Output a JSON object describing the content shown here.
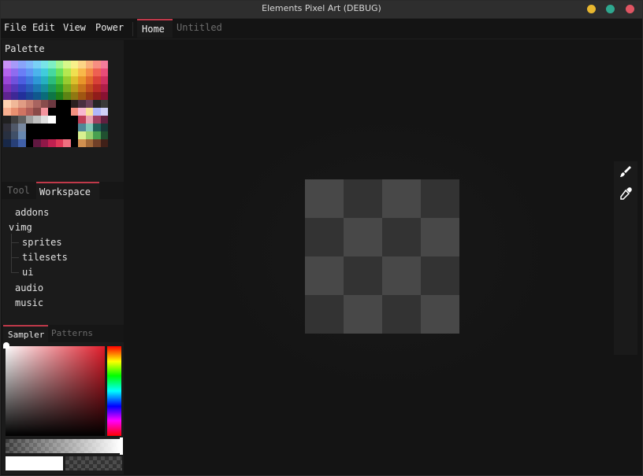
{
  "window": {
    "title": "Elements Pixel Art (DEBUG)",
    "controls": {
      "minimize_color": "#e8b72f",
      "maximize_color": "#2ea88f",
      "close_color": "#e05563"
    }
  },
  "menubar": {
    "items": [
      "File",
      "Edit",
      "View",
      "Power"
    ],
    "tabs": [
      {
        "label": "Home",
        "active": true
      },
      {
        "label": "Untitled",
        "active": false
      }
    ]
  },
  "palette": {
    "title": "Palette",
    "rows": [
      [
        "#c892f6",
        "#a79af8",
        "#8aa4fa",
        "#80b8fa",
        "#7ad0f6",
        "#78e4e8",
        "#7ef0c4",
        "#a2f590",
        "#d6f78a",
        "#f8f08a",
        "#fcd486",
        "#f8b07c",
        "#f68e82",
        "#f27c9a"
      ],
      [
        "#b464ec",
        "#8e6cf0",
        "#6a7ef6",
        "#5e96f4",
        "#4cb4ec",
        "#40ccdc",
        "#46d8a0",
        "#6ae25c",
        "#b4e850",
        "#f0e050",
        "#f8b84a",
        "#f48c46",
        "#ee6052",
        "#e84c78"
      ],
      [
        "#9a46d6",
        "#7052dc",
        "#4c5ee0",
        "#3e78dc",
        "#2e98d6",
        "#26b0c0",
        "#2cbc7c",
        "#4ac43c",
        "#98cc30",
        "#dcc02c",
        "#e8962a",
        "#e06a2c",
        "#d84038",
        "#d03060"
      ],
      [
        "#7c30b4",
        "#5638ba",
        "#3444be",
        "#2a5cba",
        "#1c78b2",
        "#168e9c",
        "#1a9a5c",
        "#30a228",
        "#7aaa1e",
        "#b89c1a",
        "#c8741c",
        "#c04c1e",
        "#b82a26",
        "#ae1e48"
      ],
      [
        "#5e2490",
        "#3e2896",
        "#22309a",
        "#1a4496",
        "#10588e",
        "#0a6c7a",
        "#0e7646",
        "#1e7e18",
        "#5c8414",
        "#907812",
        "#a05612",
        "#983614",
        "#901c1a",
        "#881232"
      ],
      [
        "#ffd2b0",
        "#f0b898",
        "#e09c84",
        "#c88070",
        "#a86460",
        "#884c4c",
        "#6c3840",
        "#000000",
        "#000000",
        "#2a2020",
        "#4a3040",
        "#6a4058",
        "#262626",
        "#3a3a3a"
      ],
      [
        "#f8b090",
        "#e89070",
        "#d07462",
        "#b05e58",
        "#8a4a48",
        "#f4949e",
        "#000000",
        "#000000",
        "#000000",
        "#f49080",
        "#f8b8d0",
        "#f8e098",
        "#b0b8f8",
        "#d0d0f8"
      ],
      [
        "#202020",
        "#404040",
        "#606060",
        "#a0a0a0",
        "#c0c0c0",
        "#e0e0e0",
        "#ffffff",
        "#000000",
        "#000000",
        "#000000",
        "#c04058",
        "#e8a0b0",
        "#a04060",
        "#602040"
      ],
      [
        "#30303a",
        "#505868",
        "#7888a0",
        "#000000",
        "#000000",
        "#000000",
        "#000000",
        "#000000",
        "#000000",
        "#000000",
        "#508898",
        "#80c8b8",
        "#206058",
        "#183838"
      ],
      [
        "#283040",
        "#405068",
        "#6888b0",
        "#000000",
        "#000000",
        "#000000",
        "#000000",
        "#000000",
        "#000000",
        "#000000",
        "#d8f090",
        "#98d070",
        "#48a050",
        "#205030"
      ],
      [
        "#182848",
        "#284078",
        "#4060a8",
        "#000000",
        "#601840",
        "#901848",
        "#c02050",
        "#e03858",
        "#f07080",
        "#000000",
        "#d09050",
        "#a06838",
        "#704028",
        "#402018"
      ]
    ]
  },
  "side_tabs": {
    "tool": "Tool",
    "workspace": "Workspace"
  },
  "workspace_tree": {
    "items": [
      {
        "label": "addons",
        "level": 0,
        "expanded": false
      },
      {
        "label": "img",
        "level": 0,
        "expanded": true,
        "prefix": "v"
      },
      {
        "label": "sprites",
        "level": 1
      },
      {
        "label": "tilesets",
        "level": 1
      },
      {
        "label": "ui",
        "level": 1
      },
      {
        "label": "audio",
        "level": 0
      },
      {
        "label": "music",
        "level": 0
      }
    ]
  },
  "sampler_tabs": {
    "sampler": "Sampler",
    "patterns": "Patterns"
  },
  "color_picker": {
    "hue_color": "#e01c2a",
    "primary_color": "#ffffff",
    "alpha": 1.0
  },
  "canvas": {
    "checker_light": "#484848",
    "checker_dark": "#333333",
    "grid": 4
  },
  "tools": [
    {
      "name": "brush",
      "icon": "brush-icon"
    },
    {
      "name": "color picker",
      "icon": "eyedropper-icon"
    }
  ]
}
